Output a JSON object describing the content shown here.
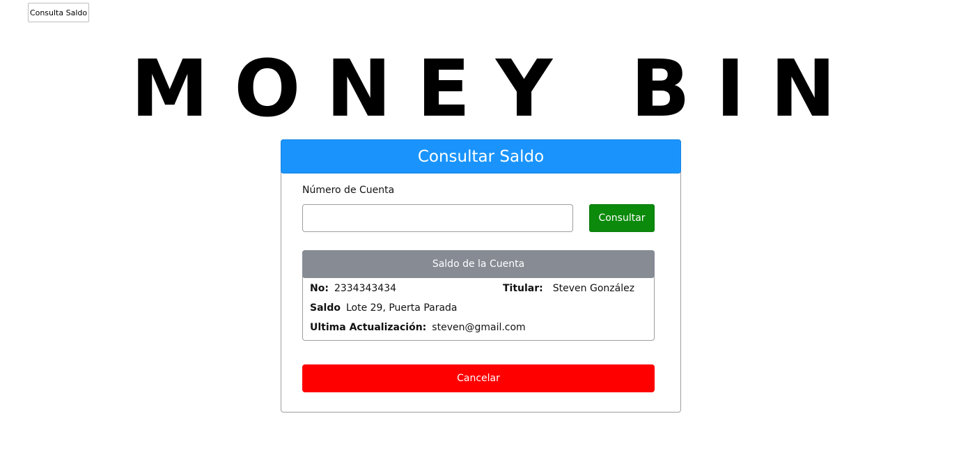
{
  "tab": {
    "label": "Consulta Saldo"
  },
  "logo": {
    "text": "MONEY BIN"
  },
  "form": {
    "title": "Consultar Saldo",
    "account_label": "Número de Cuenta",
    "account_value": "",
    "consult_button": "Consultar",
    "cancel_button": "Cancelar"
  },
  "balance": {
    "title": "Saldo de la Cuenta",
    "number_label": "No:",
    "number_value": "2334343434",
    "holder_label": "Titular:",
    "holder_value": "Steven González",
    "saldo_label": "Saldo",
    "saldo_value": "Lote 29, Puerta Parada",
    "updated_label": "Ultima Actualización:",
    "updated_value": "steven@gmail.com"
  },
  "colors": {
    "header_blue": "#1a94fc",
    "consult_green": "#0b8a0b",
    "panel_gray": "#868b94",
    "cancel_red": "#ff0000"
  }
}
